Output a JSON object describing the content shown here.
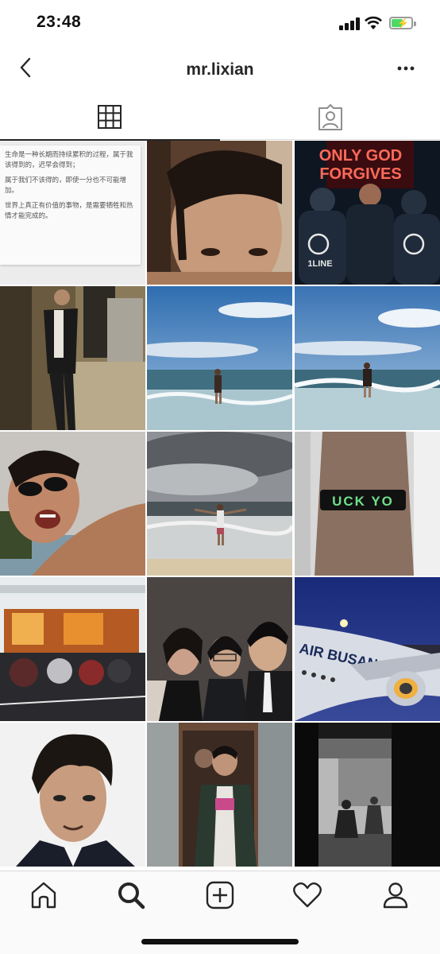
{
  "status_bar": {
    "time": "23:48",
    "battery_level": 0.6,
    "battery_color": "#4cd964"
  },
  "nav": {
    "username": "mr.lixian"
  },
  "tabs": [
    {
      "icon": "grid-icon",
      "active": true
    },
    {
      "icon": "tagged-person-icon",
      "active": false
    }
  ],
  "grid": {
    "text_post": {
      "lines": [
        "生命是一种长期而持续累积的过程，属于我该得到的，迟早会得到；",
        "属于我们不该得的，即使一分也不可能增加。",
        "世界上真正有价值的事物，是需要牺牲和热情才能完成的。"
      ]
    },
    "neon_sign": {
      "line1": "ONLY GOD",
      "line2": "FORGIVES"
    },
    "hoodie_text": "1LINE",
    "wristband_text": "UCK YO",
    "plane_text": "AIR BUSAN"
  },
  "tab_bar": {
    "items": [
      "home-icon",
      "search-icon",
      "new-post-icon",
      "activity-heart-icon",
      "profile-icon"
    ],
    "active": "search-icon"
  }
}
